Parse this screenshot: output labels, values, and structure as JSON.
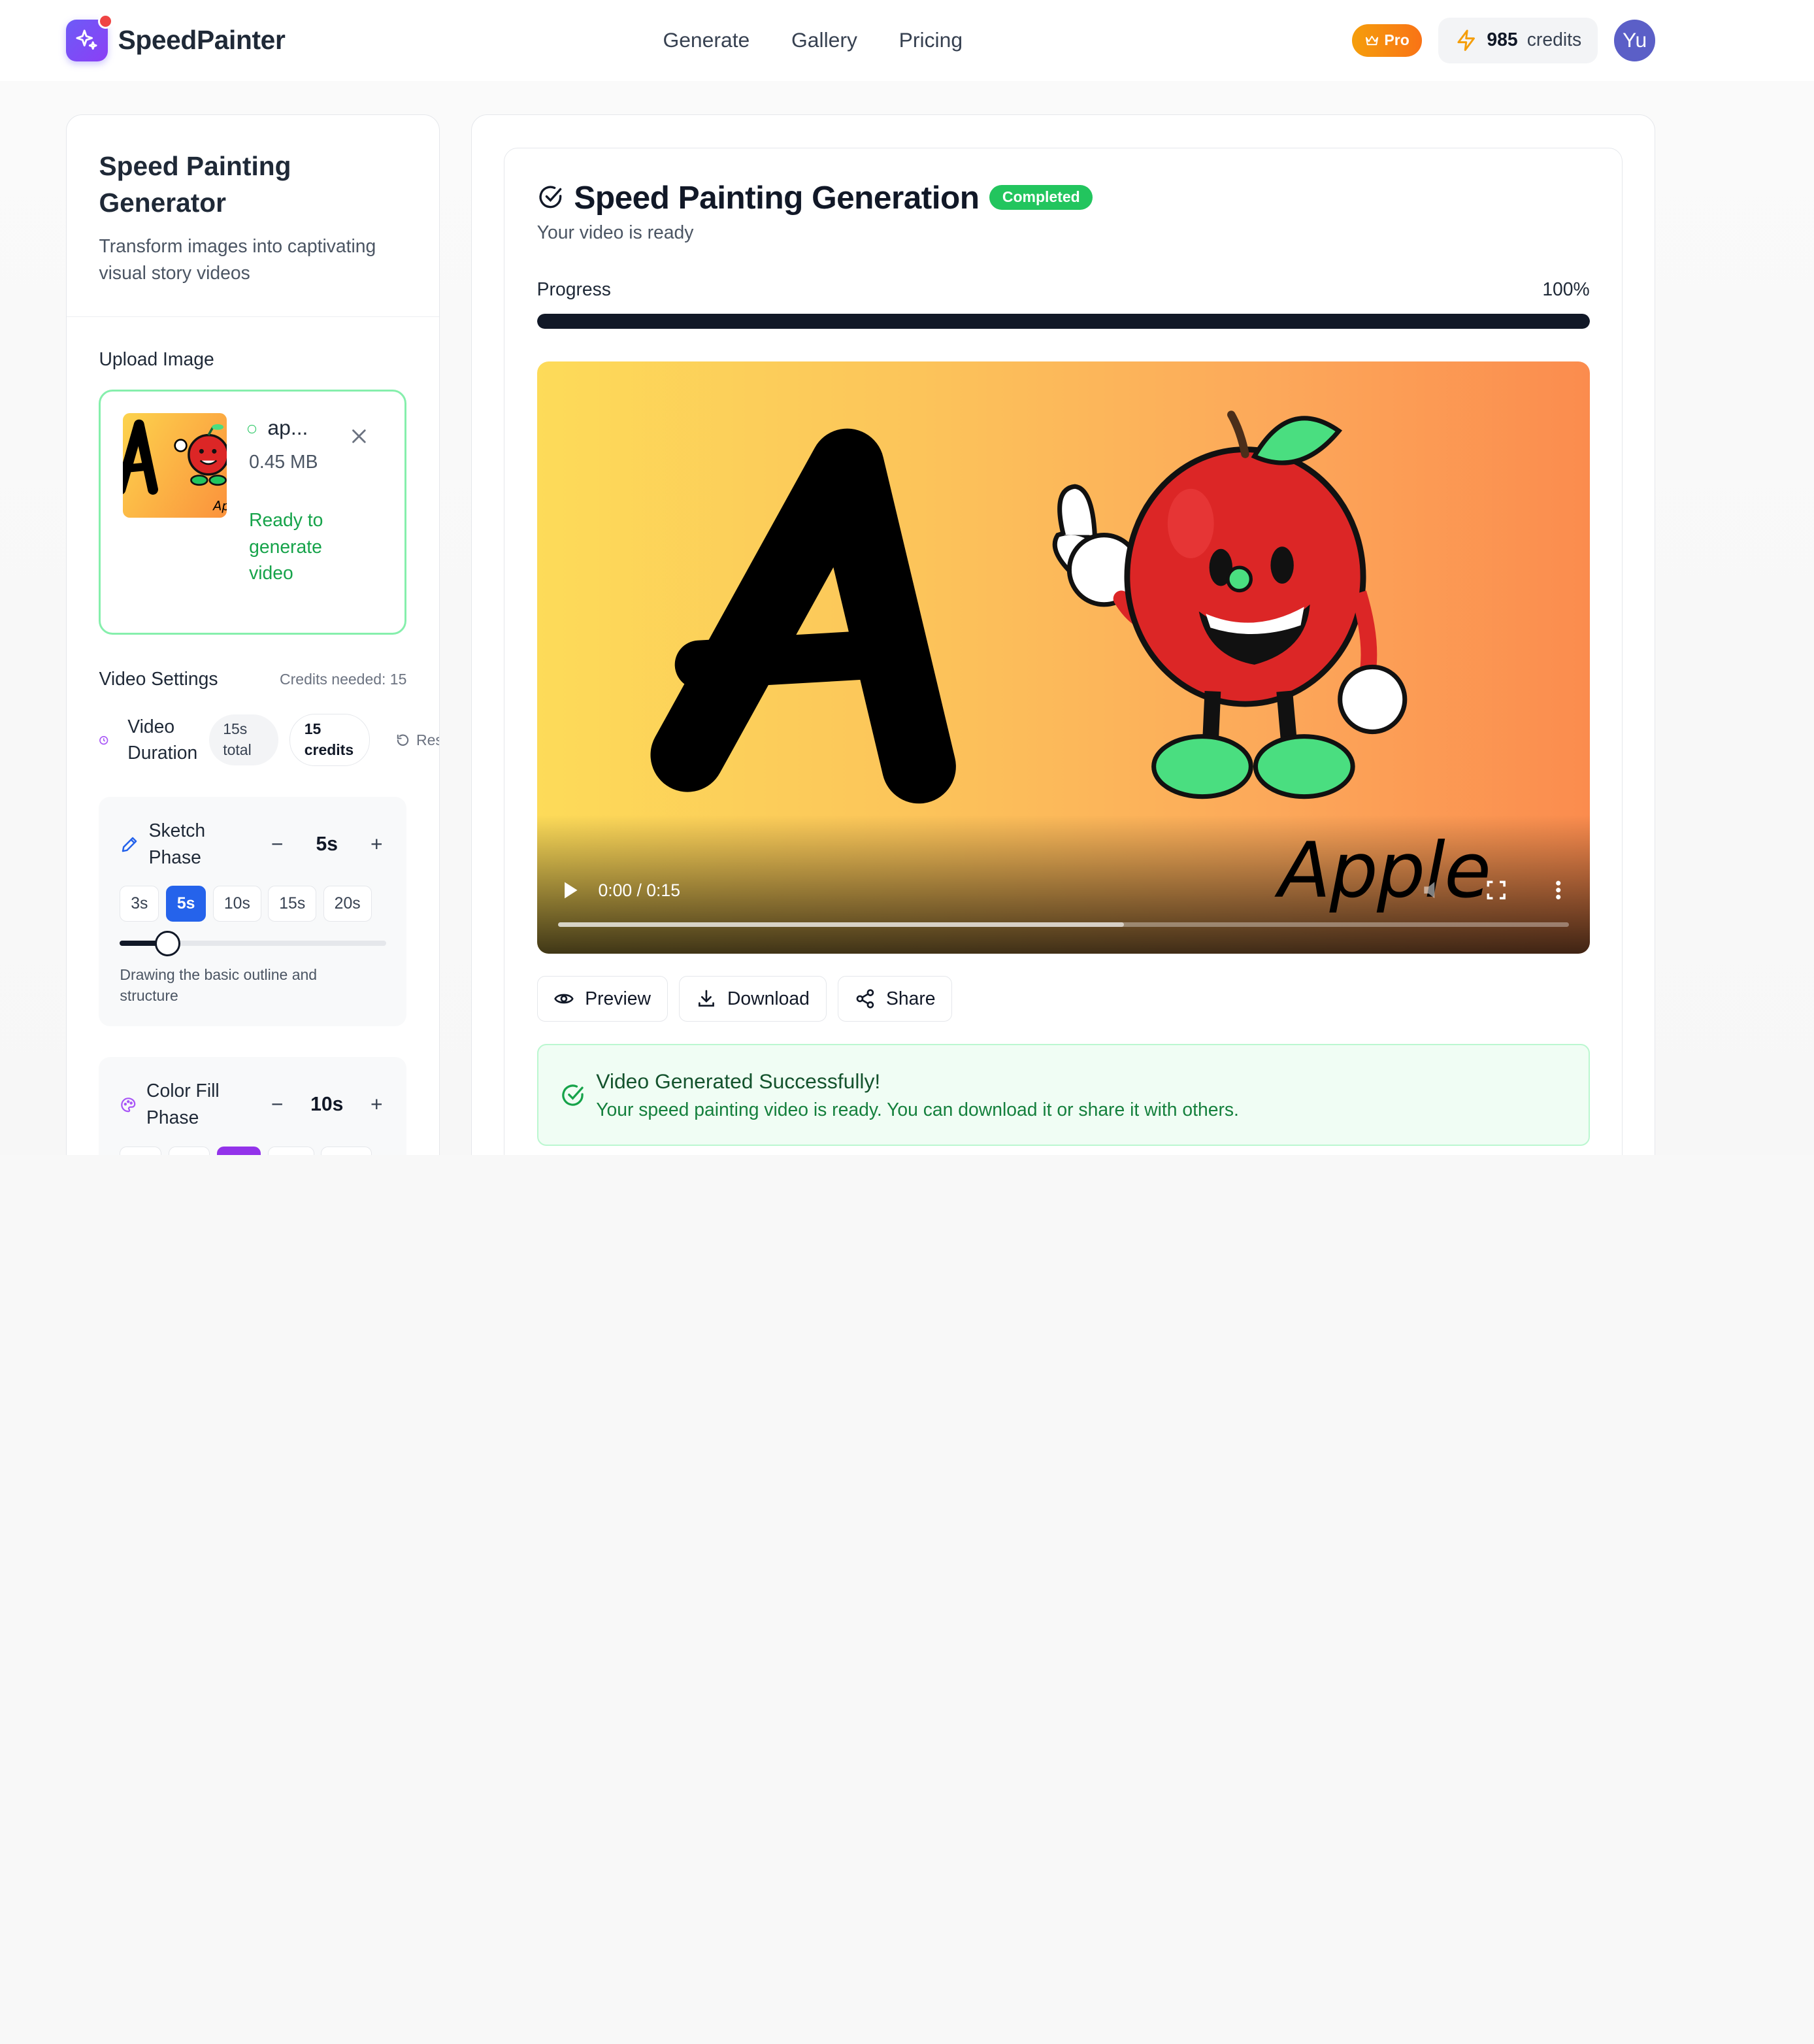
{
  "app": {
    "name": "SpeedPainter"
  },
  "nav": {
    "items": [
      "Generate",
      "Gallery",
      "Pricing"
    ]
  },
  "account": {
    "plan": "Pro",
    "credits": "985",
    "credits_label": "credits",
    "avatar_initials": "Yu"
  },
  "generator": {
    "title": "Speed Painting Generator",
    "subtitle": "Transform images into captivating visual story videos",
    "upload_label": "Upload Image",
    "file": {
      "name": "ap...",
      "size": "0.45 MB",
      "status": "Ready to generate video"
    },
    "video_settings_label": "Video Settings",
    "credits_needed": "Credits needed: 15",
    "duration": {
      "label": "Video Duration",
      "total_chip": "15s total",
      "credits_chip": "15 credits",
      "reset_label": "Rese"
    },
    "phases": [
      {
        "name": "Sketch Phase",
        "value": "5s",
        "minus": "−",
        "plus": "+",
        "presets": [
          "3s",
          "5s",
          "10s",
          "15s",
          "20s"
        ],
        "selected": "5s",
        "slider_fraction": 0.18,
        "description": "Drawing the basic outline and structure"
      },
      {
        "name": "Color Fill Phase",
        "value": "10s",
        "minus": "−",
        "plus": "+"
      }
    ]
  },
  "result": {
    "title": "Speed Painting Generation",
    "status": "Completed",
    "subtitle": "Your video is ready",
    "progress_label": "Progress",
    "progress_value": "100%",
    "progress_fraction": 1.0,
    "video": {
      "time": "0:00 / 0:15",
      "caption": "Apple",
      "buffered_fraction": 0.56
    },
    "actions": {
      "preview": "Preview",
      "download": "Download",
      "share": "Share"
    },
    "success": {
      "title": "Video Generated Successfully!",
      "message": "Your speed painting video is ready. You can download it or share it with others."
    }
  },
  "colors": {
    "accent": "#2563eb",
    "success": "#22c55e",
    "brand": "#6d5bf7",
    "pro": "#f97316"
  },
  "icons": [
    "sparkles-icon",
    "crown-icon",
    "lightning-icon",
    "close-icon",
    "clock-icon",
    "reset-icon",
    "pencil-icon",
    "palette-icon",
    "check-circle-icon",
    "play-icon",
    "mute-icon",
    "fullscreen-icon",
    "more-icon",
    "eye-icon",
    "download-icon",
    "share-icon"
  ]
}
